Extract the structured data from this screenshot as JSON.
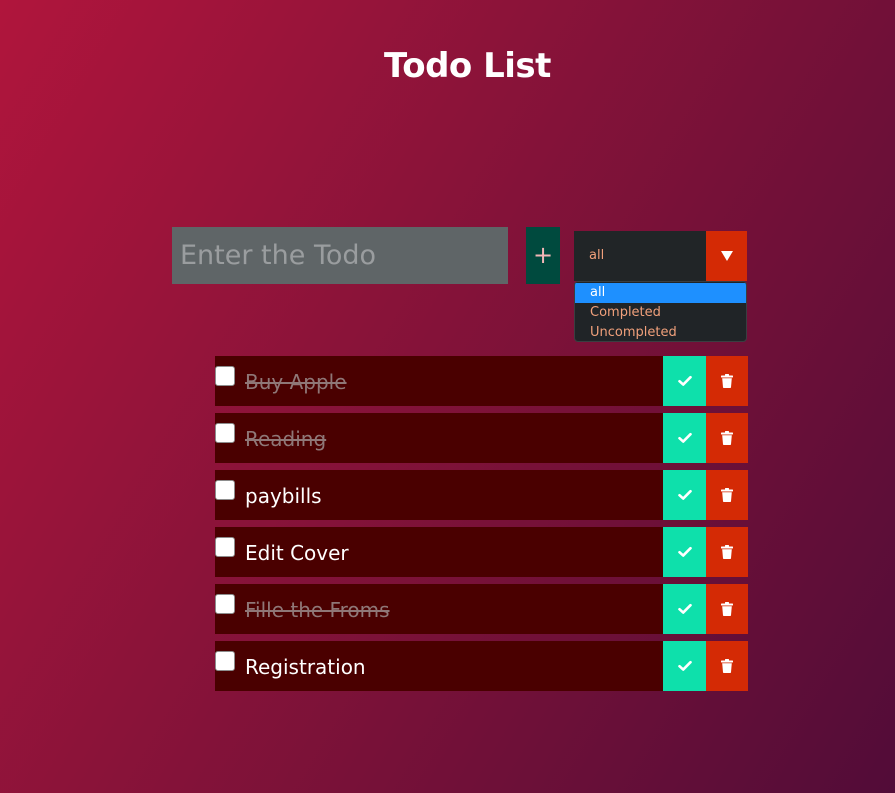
{
  "header": {
    "title": "Todo List"
  },
  "form": {
    "input_value": "",
    "input_placeholder": "Enter the Todo",
    "add_label": "+"
  },
  "filter": {
    "selected": "all",
    "options": [
      "all",
      "Completed",
      "Uncompleted"
    ],
    "open": true
  },
  "todos": [
    {
      "text": "Buy Apple",
      "completed": true
    },
    {
      "text": "Reading",
      "completed": true
    },
    {
      "text": "paybills",
      "completed": false
    },
    {
      "text": "Edit Cover",
      "completed": false
    },
    {
      "text": "Fille the Froms",
      "completed": true
    },
    {
      "text": "Registration",
      "completed": false
    }
  ],
  "icons": {
    "add": "plus-icon",
    "filter_toggle": "caret-down-icon",
    "complete": "check-icon",
    "delete": "trash-icon"
  },
  "colors": {
    "background_start": "#b0153c",
    "background_end": "#520c38",
    "input_bg": "#5f6567",
    "add_button_bg": "#004a3e",
    "select_bg": "#212527",
    "accent_orange": "#d42a05",
    "check_button_bg": "#0ee0ab",
    "todo_row_bg": "#4a0000",
    "dropdown_highlight": "#1e90ff",
    "option_text": "#f0a07b"
  }
}
